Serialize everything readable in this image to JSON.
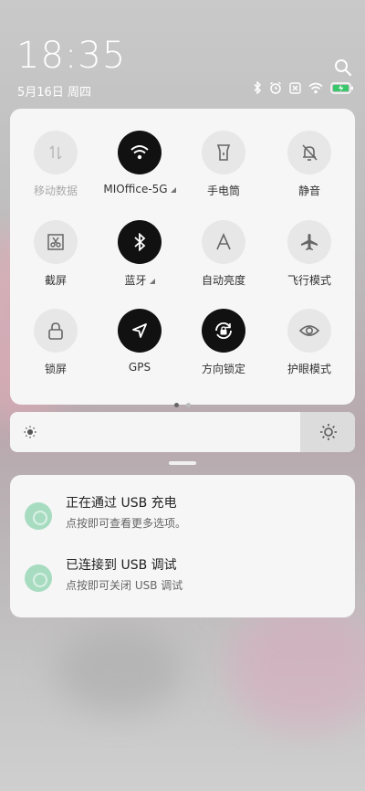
{
  "status_bar": {
    "time": "18:35",
    "date": "5月16日 周四",
    "icons": [
      "bluetooth-icon",
      "alarm-icon",
      "no-sim-icon",
      "wifi-icon",
      "battery-charging-icon"
    ]
  },
  "quick_settings": {
    "tiles": [
      {
        "id": "mobile-data",
        "label": "移动数据",
        "state": "disabled",
        "icon": "mobile-data-icon"
      },
      {
        "id": "wifi",
        "label": "MIOffice-5G",
        "state": "on",
        "icon": "wifi-icon",
        "has_more": true
      },
      {
        "id": "flashlight",
        "label": "手电筒",
        "state": "off",
        "icon": "flashlight-icon"
      },
      {
        "id": "mute",
        "label": "静音",
        "state": "off",
        "icon": "bell-off-icon"
      },
      {
        "id": "screenshot",
        "label": "截屏",
        "state": "off",
        "icon": "scissors-icon"
      },
      {
        "id": "bluetooth",
        "label": "蓝牙",
        "state": "on",
        "icon": "bluetooth-icon",
        "has_more": true
      },
      {
        "id": "auto-brightness",
        "label": "自动亮度",
        "state": "off",
        "icon": "letter-a-icon"
      },
      {
        "id": "airplane",
        "label": "飞行模式",
        "state": "off",
        "icon": "airplane-icon"
      },
      {
        "id": "lock-screen",
        "label": "锁屏",
        "state": "off",
        "icon": "lock-icon"
      },
      {
        "id": "gps",
        "label": "GPS",
        "state": "on",
        "icon": "navigation-arrow-icon"
      },
      {
        "id": "rotation-lock",
        "label": "方向锁定",
        "state": "on",
        "icon": "rotation-lock-icon"
      },
      {
        "id": "eye-comfort",
        "label": "护眼模式",
        "state": "off",
        "icon": "eye-icon"
      }
    ],
    "page_count": 2,
    "current_page": 1
  },
  "brightness": {
    "level": 1.0
  },
  "notifications": [
    {
      "title": "正在通过 USB 充电",
      "subtitle": "点按即可查看更多选项。",
      "icon": "android-debug-icon"
    },
    {
      "title": "已连接到 USB 调试",
      "subtitle": "点按即可关闭 USB 调试",
      "icon": "android-debug-icon"
    }
  ]
}
